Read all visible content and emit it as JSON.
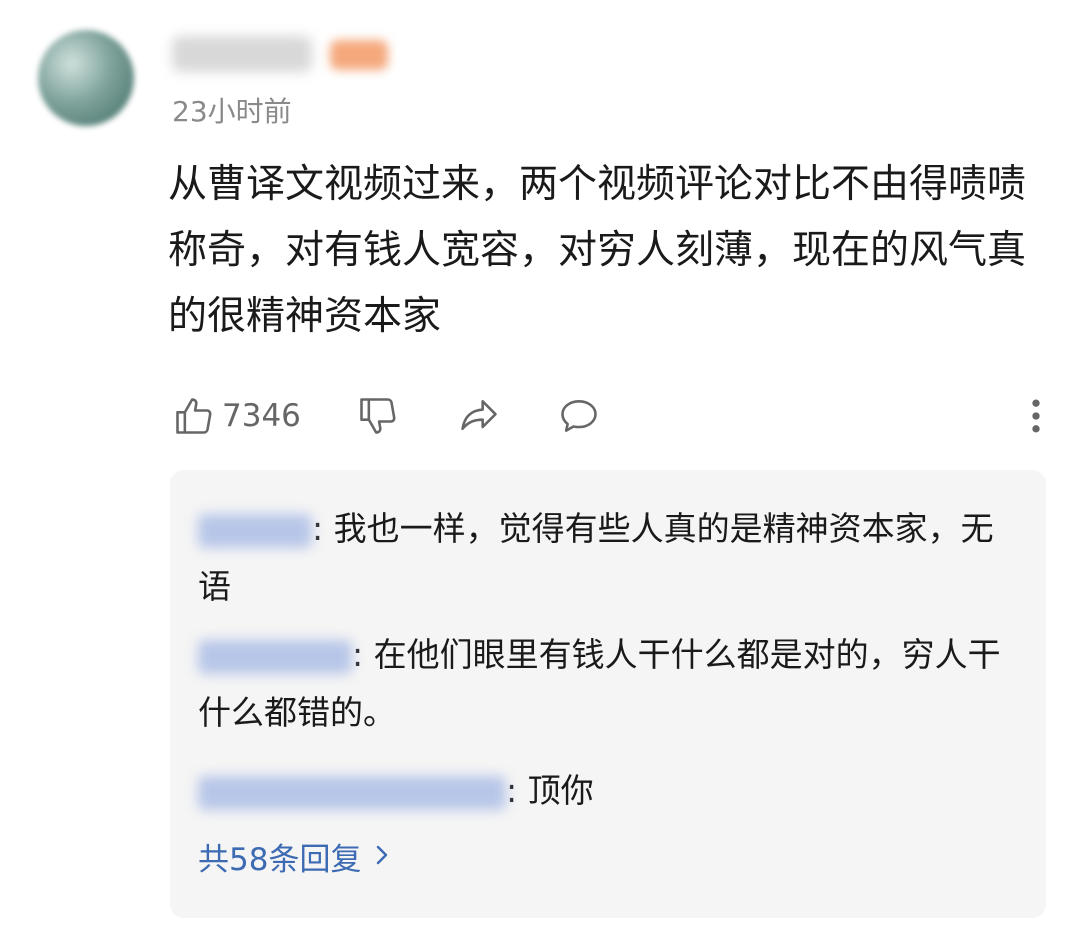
{
  "comment": {
    "time": "23小时前",
    "text": "从曹译文视频过来，两个视频评论对比不由得啧啧称奇，对有钱人宽容，对穷人刻薄，现在的风气真的很精神资本家",
    "likes": "7346"
  },
  "icons": {
    "like": "thumbs-up-icon",
    "dislike": "thumbs-down-icon",
    "share": "share-icon",
    "comment": "comment-bubble-icon",
    "more": "more-vertical-icon",
    "chevron": "chevron-right-icon"
  },
  "replies": [
    {
      "text": ": 我也一样，觉得有些人真的是精神资本家，无语"
    },
    {
      "text": ": 在他们眼里有钱人干什么都是对的，穷人干什么都错的。"
    },
    {
      "text": ": 顶你"
    }
  ],
  "more_replies_label": "共58条回复",
  "colors": {
    "link": "#3d6bb3",
    "reply_bg": "#f5f5f5",
    "muted": "#8a8a8a"
  }
}
